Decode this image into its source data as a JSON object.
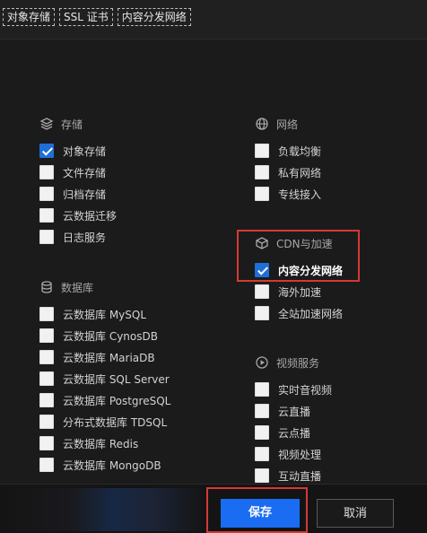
{
  "tags": [
    "对象存储",
    "SSL 证书",
    "内容分发网络"
  ],
  "storage": {
    "title": "存储",
    "icon": "layers-icon",
    "items": [
      {
        "label": "对象存储",
        "checked": true
      },
      {
        "label": "文件存储",
        "checked": false
      },
      {
        "label": "归档存储",
        "checked": false
      },
      {
        "label": "云数据迁移",
        "checked": false
      },
      {
        "label": "日志服务",
        "checked": false
      }
    ]
  },
  "database": {
    "title": "数据库",
    "icon": "database-icon",
    "items": [
      {
        "label": "云数据库 MySQL",
        "checked": false
      },
      {
        "label": "云数据库 CynosDB",
        "checked": false
      },
      {
        "label": "云数据库 MariaDB",
        "checked": false
      },
      {
        "label": "云数据库 SQL Server",
        "checked": false
      },
      {
        "label": "云数据库 PostgreSQL",
        "checked": false
      },
      {
        "label": "分布式数据库 TDSQL",
        "checked": false
      },
      {
        "label": "云数据库 Redis",
        "checked": false
      },
      {
        "label": "云数据库 MongoDB",
        "checked": false
      }
    ]
  },
  "network": {
    "title": "网络",
    "icon": "globe-icon",
    "items": [
      {
        "label": "负载均衡",
        "checked": false
      },
      {
        "label": "私有网络",
        "checked": false
      },
      {
        "label": "专线接入",
        "checked": false
      }
    ]
  },
  "cdn": {
    "title": "CDN与加速",
    "icon": "cube-icon",
    "items": [
      {
        "label": "内容分发网络",
        "checked": true
      },
      {
        "label": "海外加速",
        "checked": false
      },
      {
        "label": "全站加速网络",
        "checked": false
      }
    ]
  },
  "video": {
    "title": "视频服务",
    "icon": "play-circle-icon",
    "items": [
      {
        "label": "实时音视频",
        "checked": false
      },
      {
        "label": "云直播",
        "checked": false
      },
      {
        "label": "云点播",
        "checked": false
      },
      {
        "label": "视频处理",
        "checked": false
      },
      {
        "label": "互动直播",
        "checked": false
      }
    ]
  },
  "footer": {
    "save_label": "保存",
    "cancel_label": "取消"
  },
  "colors": {
    "accent": "#1a6df2",
    "highlight": "#d43a33",
    "checked": "#1f6fd8"
  }
}
